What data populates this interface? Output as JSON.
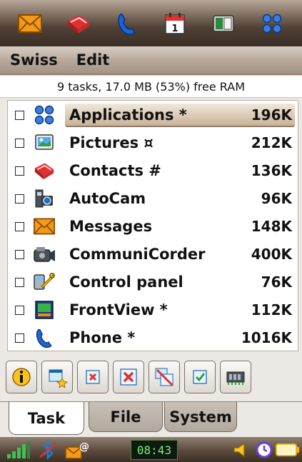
{
  "top_apps": [
    {
      "name": "messages-icon"
    },
    {
      "name": "contacts-icon"
    },
    {
      "name": "phone-icon"
    },
    {
      "name": "calendar-icon"
    },
    {
      "name": "frontview-icon"
    },
    {
      "name": "applications-icon"
    }
  ],
  "menu": {
    "items": [
      "Swiss",
      "Edit"
    ]
  },
  "status_line": "9 tasks, 17.0 MB (53%) free RAM",
  "tasks": [
    {
      "label": "Applications *",
      "size": "196K",
      "icon": "applications-icon",
      "selected": true
    },
    {
      "label": "Pictures ¤",
      "size": "212K",
      "icon": "pictures-icon",
      "selected": false
    },
    {
      "label": "Contacts #",
      "size": "136K",
      "icon": "contacts-icon",
      "selected": false
    },
    {
      "label": "AutoCam",
      "size": "96K",
      "icon": "camera-icon",
      "selected": false
    },
    {
      "label": "Messages",
      "size": "148K",
      "icon": "messages-icon",
      "selected": false
    },
    {
      "label": "CommuniCorder",
      "size": "400K",
      "icon": "camcorder-icon",
      "selected": false
    },
    {
      "label": "Control panel",
      "size": "76K",
      "icon": "control-panel-icon",
      "selected": false
    },
    {
      "label": "FrontView *",
      "size": "112K",
      "icon": "frontview-icon",
      "selected": false
    },
    {
      "label": "Phone *",
      "size": "1016K",
      "icon": "phone-icon",
      "selected": false
    }
  ],
  "toolbar": [
    {
      "name": "info-icon"
    },
    {
      "name": "new-task-icon"
    },
    {
      "name": "close-task-icon"
    },
    {
      "name": "close-all-icon"
    },
    {
      "name": "close-others-icon"
    },
    {
      "name": "select-icon"
    },
    {
      "name": "memory-icon"
    }
  ],
  "tabs": [
    {
      "label": "Task",
      "active": true
    },
    {
      "label": "File",
      "active": false
    },
    {
      "label": "System",
      "active": false
    }
  ],
  "bottom": {
    "clock": "08:43",
    "icons": [
      "signal-icon",
      "bluetooth-icon",
      "message-status-icon",
      "volume-icon",
      "alarm-icon",
      "battery-icon"
    ]
  },
  "colors": {
    "highlight": "#d9c7b1",
    "topbar": "#4f4035",
    "clock_text": "#7ef07a"
  }
}
